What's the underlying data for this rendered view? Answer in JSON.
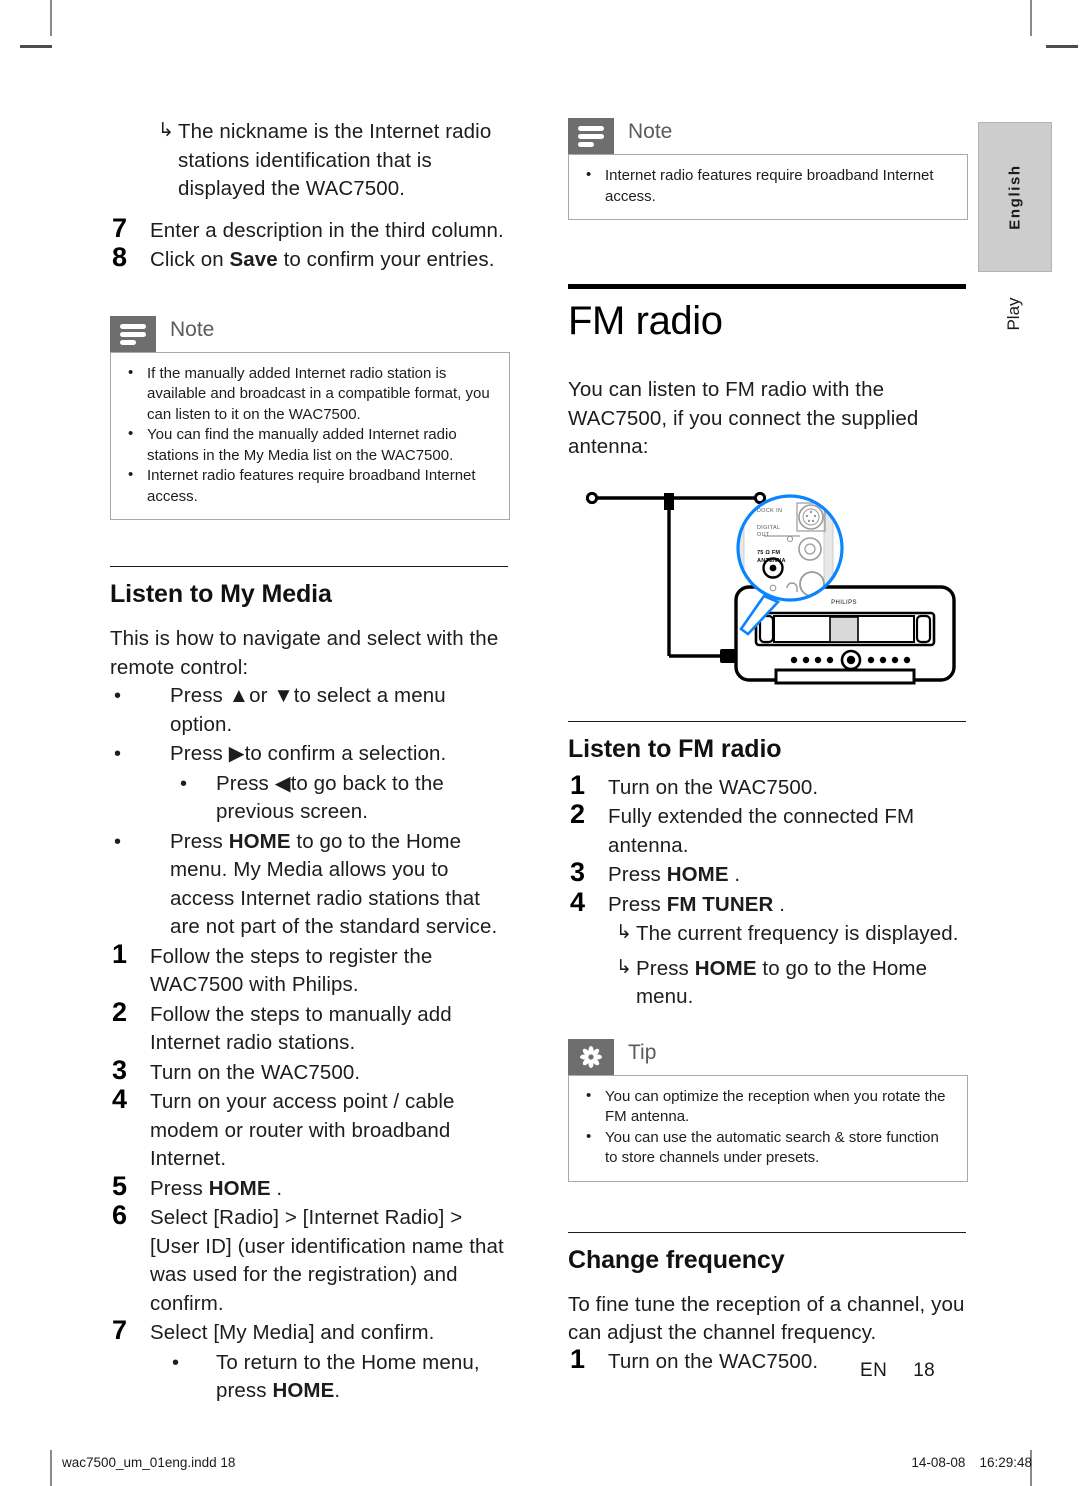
{
  "document": {
    "language_tab": "English",
    "section_tab": "Play",
    "folio_lang": "EN",
    "folio_page": "18",
    "imprint_file": "wac7500_um_01eng.indd   18",
    "imprint_date": "14-08-08",
    "imprint_time": "16:29:48"
  },
  "left_column": {
    "intro_arrow": "The nickname is the Internet radio stations identification that is displayed the WAC7500.",
    "step7": {
      "num": "7",
      "text": "Enter a description in the third column."
    },
    "step8": {
      "num": "8",
      "text_before": "Click on ",
      "bold": "Save",
      "text_after": " to confirm your entries."
    },
    "note": {
      "label": "Note",
      "icon": "note-icon",
      "items": [
        "If the manually added Internet radio station is available and broadcast in a compatible format, you can listen to it on the WAC7500.",
        "You can find the manually added Internet radio stations in the My Media list on the WAC7500.",
        "Internet radio features require broadband Internet access."
      ]
    },
    "my_media": {
      "heading": "Listen to My Media",
      "intro": "This is how to navigate and select with the remote control:",
      "bullets": [
        {
          "text_before": "Press ",
          "glyph1": "▲",
          "mid": "or ",
          "glyph2": "▼",
          "text_after": "to select a menu option."
        },
        {
          "text_before": "Press ",
          "glyph1": "▶",
          "text_after": "to confirm a selection."
        }
      ],
      "sub_bullet": {
        "text_before": "Press ",
        "glyph1": "◀",
        "text_after": "to go back to the previous screen."
      },
      "home_bullet": {
        "before": "Press ",
        "bold": "HOME",
        "after": " to go to the Home menu. My Media allows you to access Internet radio stations that are not part of the standard service."
      },
      "steps": [
        {
          "num": "1",
          "text": "Follow the steps to register the WAC7500 with Philips."
        },
        {
          "num": "2",
          "text": "Follow the steps to manually add Internet radio stations."
        },
        {
          "num": "3",
          "text": "Turn on the WAC7500."
        },
        {
          "num": "4",
          "text": "Turn on your access point / cable modem or router with broadband Internet."
        }
      ],
      "step5": {
        "num": "5",
        "before": "Press ",
        "bold": "HOME",
        "after": " ."
      },
      "step6": {
        "num": "6",
        "text": "Select [Radio] > [Internet Radio] > [User ID] (user identification name that was used for the registration) and confirm."
      },
      "step7": {
        "num": "7",
        "text": "Select [My Media] and confirm."
      },
      "step7_sub": {
        "before": "To return to the Home menu, press ",
        "bold": "HOME",
        "after": "."
      }
    }
  },
  "right_column": {
    "note": {
      "label": "Note",
      "icon": "note-icon",
      "items": [
        "Internet radio features require broadband Internet access."
      ]
    },
    "chapter": {
      "title": "FM radio",
      "intro": "You can listen to FM radio with the WAC7500, if you connect the supplied antenna:"
    },
    "diagram": {
      "name": "fm-antenna-connection-diagram",
      "brand": "PHILIPS",
      "callout_labels": [
        "DOCK IN",
        "DIGITAL OUT",
        "75 Ω FM ANTENNA"
      ],
      "accent_color": "#0a84ff"
    },
    "listen_fm": {
      "heading": "Listen to FM radio",
      "steps": [
        {
          "num": "1",
          "text": "Turn on the WAC7500."
        },
        {
          "num": "2",
          "text": "Fully extended the connected FM antenna."
        }
      ],
      "step3": {
        "num": "3",
        "before": "Press ",
        "bold": "HOME",
        "after": " ."
      },
      "step4": {
        "num": "4",
        "before": "Press ",
        "bold": "FM TUNER",
        "after": " ."
      },
      "arrow1": "The current frequency is displayed.",
      "arrow2": {
        "before": "Press ",
        "bold": "HOME",
        "after": " to go to the Home menu."
      }
    },
    "tip": {
      "label": "Tip",
      "icon": "tip-icon",
      "items": [
        "You can optimize the reception when you rotate the FM antenna.",
        "You can use the automatic search & store function to store channels under presets."
      ]
    },
    "change_frequency": {
      "heading": "Change frequency",
      "intro": "To fine tune the reception of a channel, you can adjust the channel frequency.",
      "step1": {
        "num": "1",
        "text": "Turn on the WAC7500."
      }
    }
  }
}
